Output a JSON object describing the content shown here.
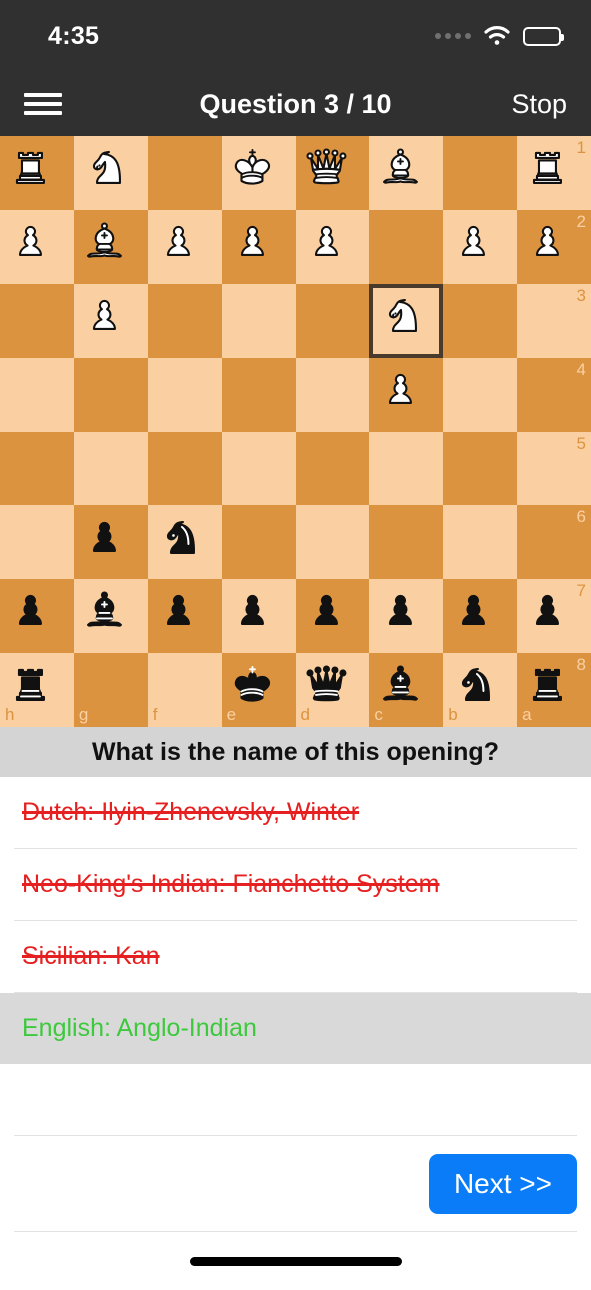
{
  "status_bar": {
    "time": "4:35",
    "signal_icon": "signal-dots-icon",
    "wifi_icon": "wifi-icon",
    "battery_icon": "battery-full-icon"
  },
  "nav_bar": {
    "menu_icon": "hamburger-menu-icon",
    "title": "Question 3 / 10",
    "action_label": "Stop"
  },
  "board": {
    "orientation": "black",
    "files": [
      "h",
      "g",
      "f",
      "e",
      "d",
      "c",
      "b",
      "a"
    ],
    "ranks": [
      "1",
      "2",
      "3",
      "4",
      "5",
      "6",
      "7",
      "8"
    ],
    "light_color": "#FAD0A2",
    "dark_color": "#DC9340",
    "highlight_color": "#4a3a2c",
    "highlighted_squares": [
      "c3"
    ],
    "rows": [
      [
        "wR",
        "wN",
        "",
        "wK",
        "wQ",
        "wB",
        "",
        "wR"
      ],
      [
        "wP",
        "wB",
        "wP",
        "wP",
        "wP",
        "",
        "wP",
        "wP"
      ],
      [
        "",
        "wP",
        "",
        "",
        "",
        "wN",
        "",
        ""
      ],
      [
        "",
        "",
        "",
        "",
        "",
        "wP",
        "",
        ""
      ],
      [
        "",
        "",
        "",
        "",
        "",
        "",
        "",
        ""
      ],
      [
        "",
        "bP",
        "bN",
        "",
        "",
        "",
        "",
        ""
      ],
      [
        "bP",
        "bB",
        "bP",
        "bP",
        "bP",
        "bP",
        "bP",
        "bP"
      ],
      [
        "bR",
        "",
        "",
        "bK",
        "bQ",
        "bB",
        "bN",
        "bR"
      ]
    ]
  },
  "question": {
    "text": "What is the name of this opening?"
  },
  "answers": [
    {
      "label": "Dutch: Ilyin-Zhenevsky, Winter",
      "state": "wrong"
    },
    {
      "label": "Neo-King's Indian: Fianchetto System",
      "state": "wrong"
    },
    {
      "label": "Sicilian: Kan",
      "state": "wrong"
    },
    {
      "label": "English: Anglo-Indian",
      "state": "correct"
    }
  ],
  "footer": {
    "next_label": "Next >>",
    "next_color": "#0a7cf7"
  },
  "colors": {
    "wrong": "#e62020",
    "correct": "#3cc93c",
    "question_bar": "#d4d4d4",
    "nav_bar": "#303030"
  }
}
